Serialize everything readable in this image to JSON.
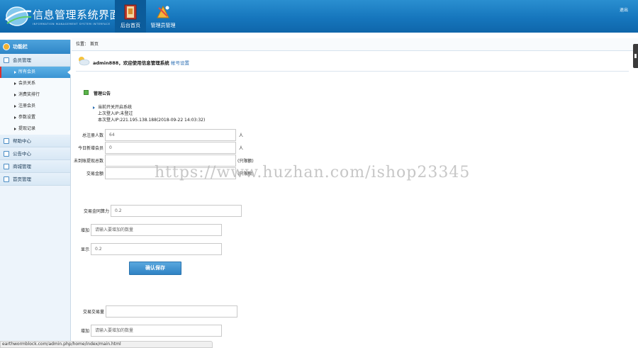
{
  "header": {
    "title": "信息管理系统界面",
    "subtitle": "INFORMATION MANAGEMENT SYSTEM INTERFACE",
    "nav": [
      {
        "label": "后台首页",
        "icon": "book-icon",
        "active": true
      },
      {
        "label": "管理员管理",
        "icon": "tools-icon",
        "active": false
      }
    ],
    "logout": "退出"
  },
  "sidebar": {
    "header": "功能栏",
    "groups": [
      {
        "label": "会员管理",
        "items": [
          {
            "label": "所有会员",
            "active": true
          },
          {
            "label": "会员关系"
          },
          {
            "label": "消费奖排行"
          },
          {
            "label": "注册会员"
          },
          {
            "label": "参数设置"
          },
          {
            "label": "提现记录"
          }
        ]
      },
      {
        "label": "帮助中心"
      },
      {
        "label": "公告中心"
      },
      {
        "label": "商城管理"
      },
      {
        "label": "首页管理"
      }
    ]
  },
  "main": {
    "breadcrumb": "位置： 首页",
    "welcome": "admin888，欢迎使用信息管理系统",
    "account_link": "帐号设置",
    "notice_title": "管理公告",
    "notices": [
      "当前开关开启系统",
      "上次登入IP:未登过",
      "本次登入IP:221.195.138.188(2018-09-22 14:03:32)"
    ],
    "stats": [
      {
        "label": "总注册人数",
        "value": "64",
        "unit": "人"
      },
      {
        "label": "今日新增会员",
        "value": "0",
        "unit": "人"
      },
      {
        "label": "未到账提现总数",
        "value": "",
        "unit": "(只限额)"
      },
      {
        "label": "交易金额",
        "value": "",
        "unit": "(只限额)"
      }
    ],
    "setting_block_1": {
      "rate_label": "交易金同算力",
      "rate_value": "0.2",
      "add_label": "增加",
      "add_placeholder": "请输入要增加的数量",
      "show_label": "显示",
      "show_value": "0.2"
    },
    "save_button": "确认保存",
    "setting_block_2": {
      "volume_label": "交易交易量",
      "volume_value": "",
      "add_label": "增加",
      "add_placeholder": "请输入要增加的数量"
    }
  },
  "watermark": "https://www.huzhan.com/ishop23345",
  "status_url": "earthwormblock.com/admin.php/home/index/main.html"
}
